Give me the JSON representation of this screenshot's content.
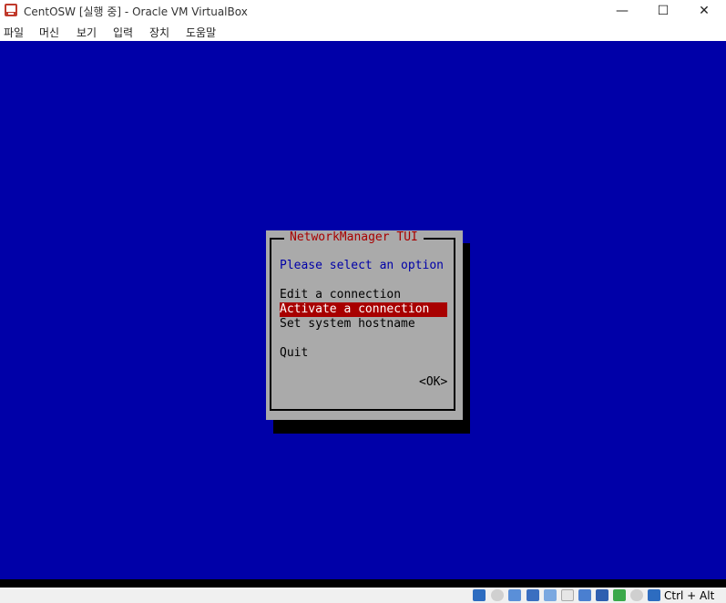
{
  "window": {
    "title": "CentOSW [실행 중] - Oracle VM VirtualBox",
    "minimize_glyph": "—",
    "maximize_glyph": "☐",
    "close_glyph": "✕"
  },
  "menu": [
    "파일",
    "머신",
    "보기",
    "입력",
    "장치",
    "도움말"
  ],
  "tui": {
    "title": "NetworkManager TUI",
    "prompt": "Please select an option",
    "options": [
      "Edit a connection",
      "Activate a connection",
      "Set system hostname",
      "Quit"
    ],
    "selected_index": 1,
    "ok_label": "<OK>"
  },
  "statusbar": {
    "icons": [
      "optical-drive-icon",
      "audio-icon",
      "network-icon",
      "usb-icon",
      "shared-folders-icon",
      "display-icon",
      "video-capture-icon",
      "cpu-icon",
      "mouse-integration-icon",
      "keyboard-icon",
      "host-key-arrow-icon"
    ],
    "host_key": "Ctrl + Alt"
  },
  "colors": {
    "vm_background": "#0000a8",
    "dialog_background": "#aaaaaa",
    "title_text": "#a80000",
    "selection": "#a80000",
    "prompt_text": "#0000a8"
  }
}
